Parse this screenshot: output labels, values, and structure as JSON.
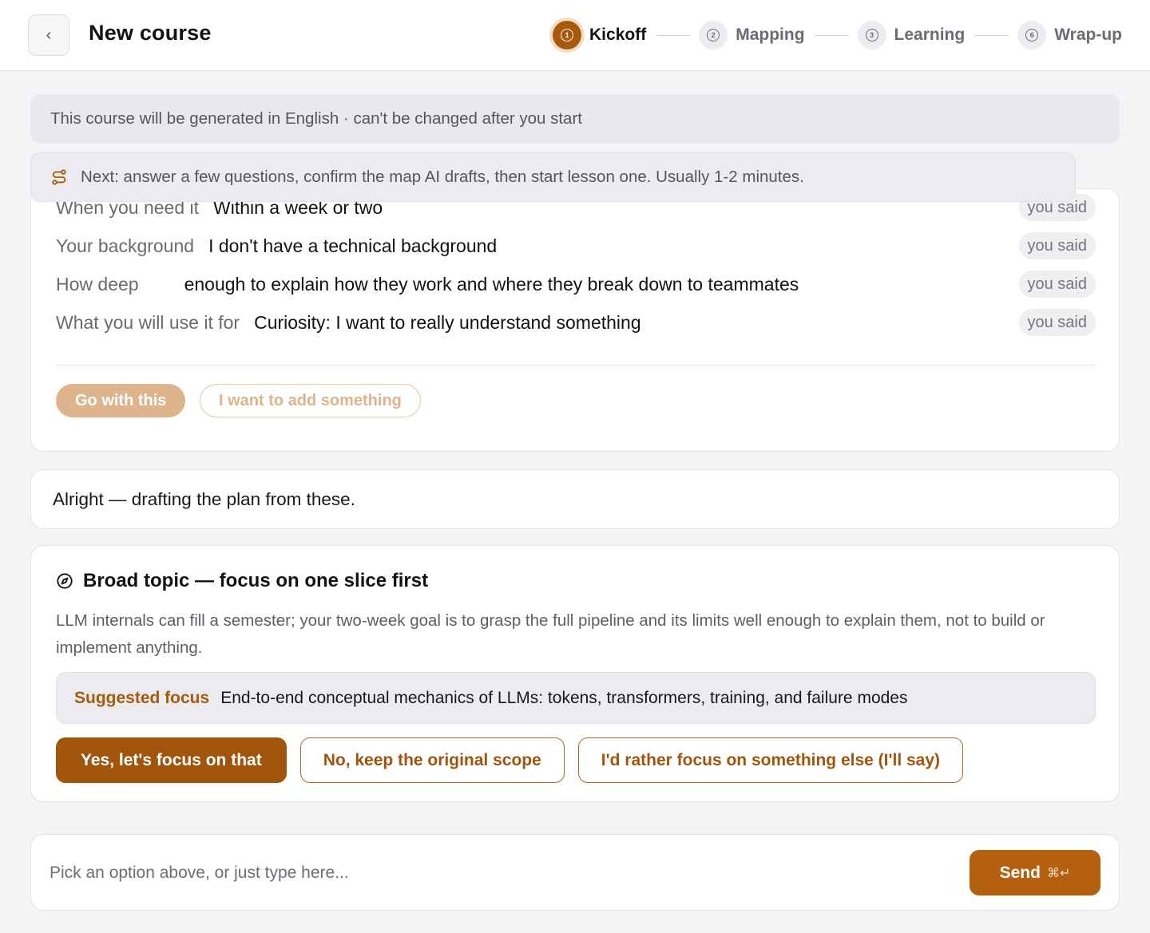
{
  "header": {
    "back_icon": "chevron-left-icon",
    "title": "New course",
    "steps": [
      {
        "number": "1",
        "label": "Kickoff",
        "active": true
      },
      {
        "number": "2",
        "label": "Mapping",
        "active": false
      },
      {
        "number": "3",
        "label": "Learning",
        "active": false
      },
      {
        "number": "6",
        "label": "Wrap-up",
        "active": false
      }
    ]
  },
  "notices": {
    "language": "This course will be generated in English · can't be changed after you start",
    "next_icon": "route-icon",
    "next": "Next: answer a few questions, confirm the map AI drafts, then start lesson one. Usually 1-2 minutes."
  },
  "summary": {
    "rows": [
      {
        "label": "When you need it",
        "value": "Within a week or two",
        "tag": "you said"
      },
      {
        "label": "Your background",
        "value": "I don't have a technical background",
        "tag": "you said"
      },
      {
        "label": "How deep",
        "value": "enough to explain how they work and where they break down to teammates",
        "tag": "you said"
      },
      {
        "label": "What you will use it for",
        "value": "Curiosity: I want to really understand something",
        "tag": "you said"
      }
    ],
    "go_label": "Go with this",
    "add_label": "I want to add something"
  },
  "assistant_message": "Alright — drafting the plan from these.",
  "focus": {
    "icon": "compass-icon",
    "title": "Broad topic — focus on one slice first",
    "description": "LLM internals can fill a semester; your two-week goal is to grasp the full pipeline and its limits well enough to explain them, not to build or implement anything.",
    "suggested_label": "Suggested focus",
    "suggested_value": "End-to-end conceptual mechanics of LLMs: tokens, transformers, training, and failure modes",
    "actions": {
      "yes": "Yes, let's focus on that",
      "no": "No, keep the original scope",
      "else": "I'd rather focus on something else (I'll say)"
    }
  },
  "composer": {
    "placeholder": "Pick an option above, or just type here...",
    "send_label": "Send",
    "send_shortcut": "⌘↵"
  },
  "colors": {
    "accent": "#a0540c",
    "accent_muted": "#ddb48c",
    "background": "#f4f4f6"
  }
}
